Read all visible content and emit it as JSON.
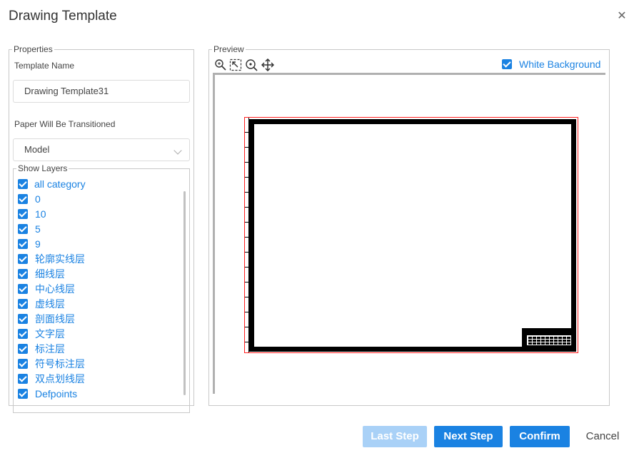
{
  "dialog": {
    "title": "Drawing Template"
  },
  "properties": {
    "legend": "Properties",
    "template_name_label": "Template Name",
    "template_name_value": "Drawing Template31",
    "paper_label": "Paper Will Be Transitioned",
    "paper_value": "Model",
    "layers_legend": "Show Layers",
    "layers": [
      {
        "name": "all category",
        "checked": true
      },
      {
        "name": "0",
        "checked": true
      },
      {
        "name": "10",
        "checked": true
      },
      {
        "name": "5",
        "checked": true
      },
      {
        "name": "9",
        "checked": true
      },
      {
        "name": "轮廓实线层",
        "checked": true
      },
      {
        "name": "细线层",
        "checked": true
      },
      {
        "name": "中心线层",
        "checked": true
      },
      {
        "name": "虚线层",
        "checked": true
      },
      {
        "name": "剖面线层",
        "checked": true
      },
      {
        "name": "文字层",
        "checked": true
      },
      {
        "name": "标注层",
        "checked": true
      },
      {
        "name": "符号标注层",
        "checked": true
      },
      {
        "name": "双点划线层",
        "checked": true
      },
      {
        "name": "Defpoints",
        "checked": true
      }
    ]
  },
  "preview": {
    "legend": "Preview",
    "tools": [
      "zoom-icon",
      "zoom-extents-icon",
      "zoom-window-icon",
      "pan-icon"
    ],
    "white_background_label": "White Background",
    "white_background_checked": true
  },
  "footer": {
    "last_step": "Last Step",
    "next_step": "Next Step",
    "confirm": "Confirm",
    "cancel": "Cancel"
  },
  "colors": {
    "accent": "#1a82e2",
    "disabled_accent": "#a9d1f7",
    "sheet_border": "#ff2020"
  }
}
